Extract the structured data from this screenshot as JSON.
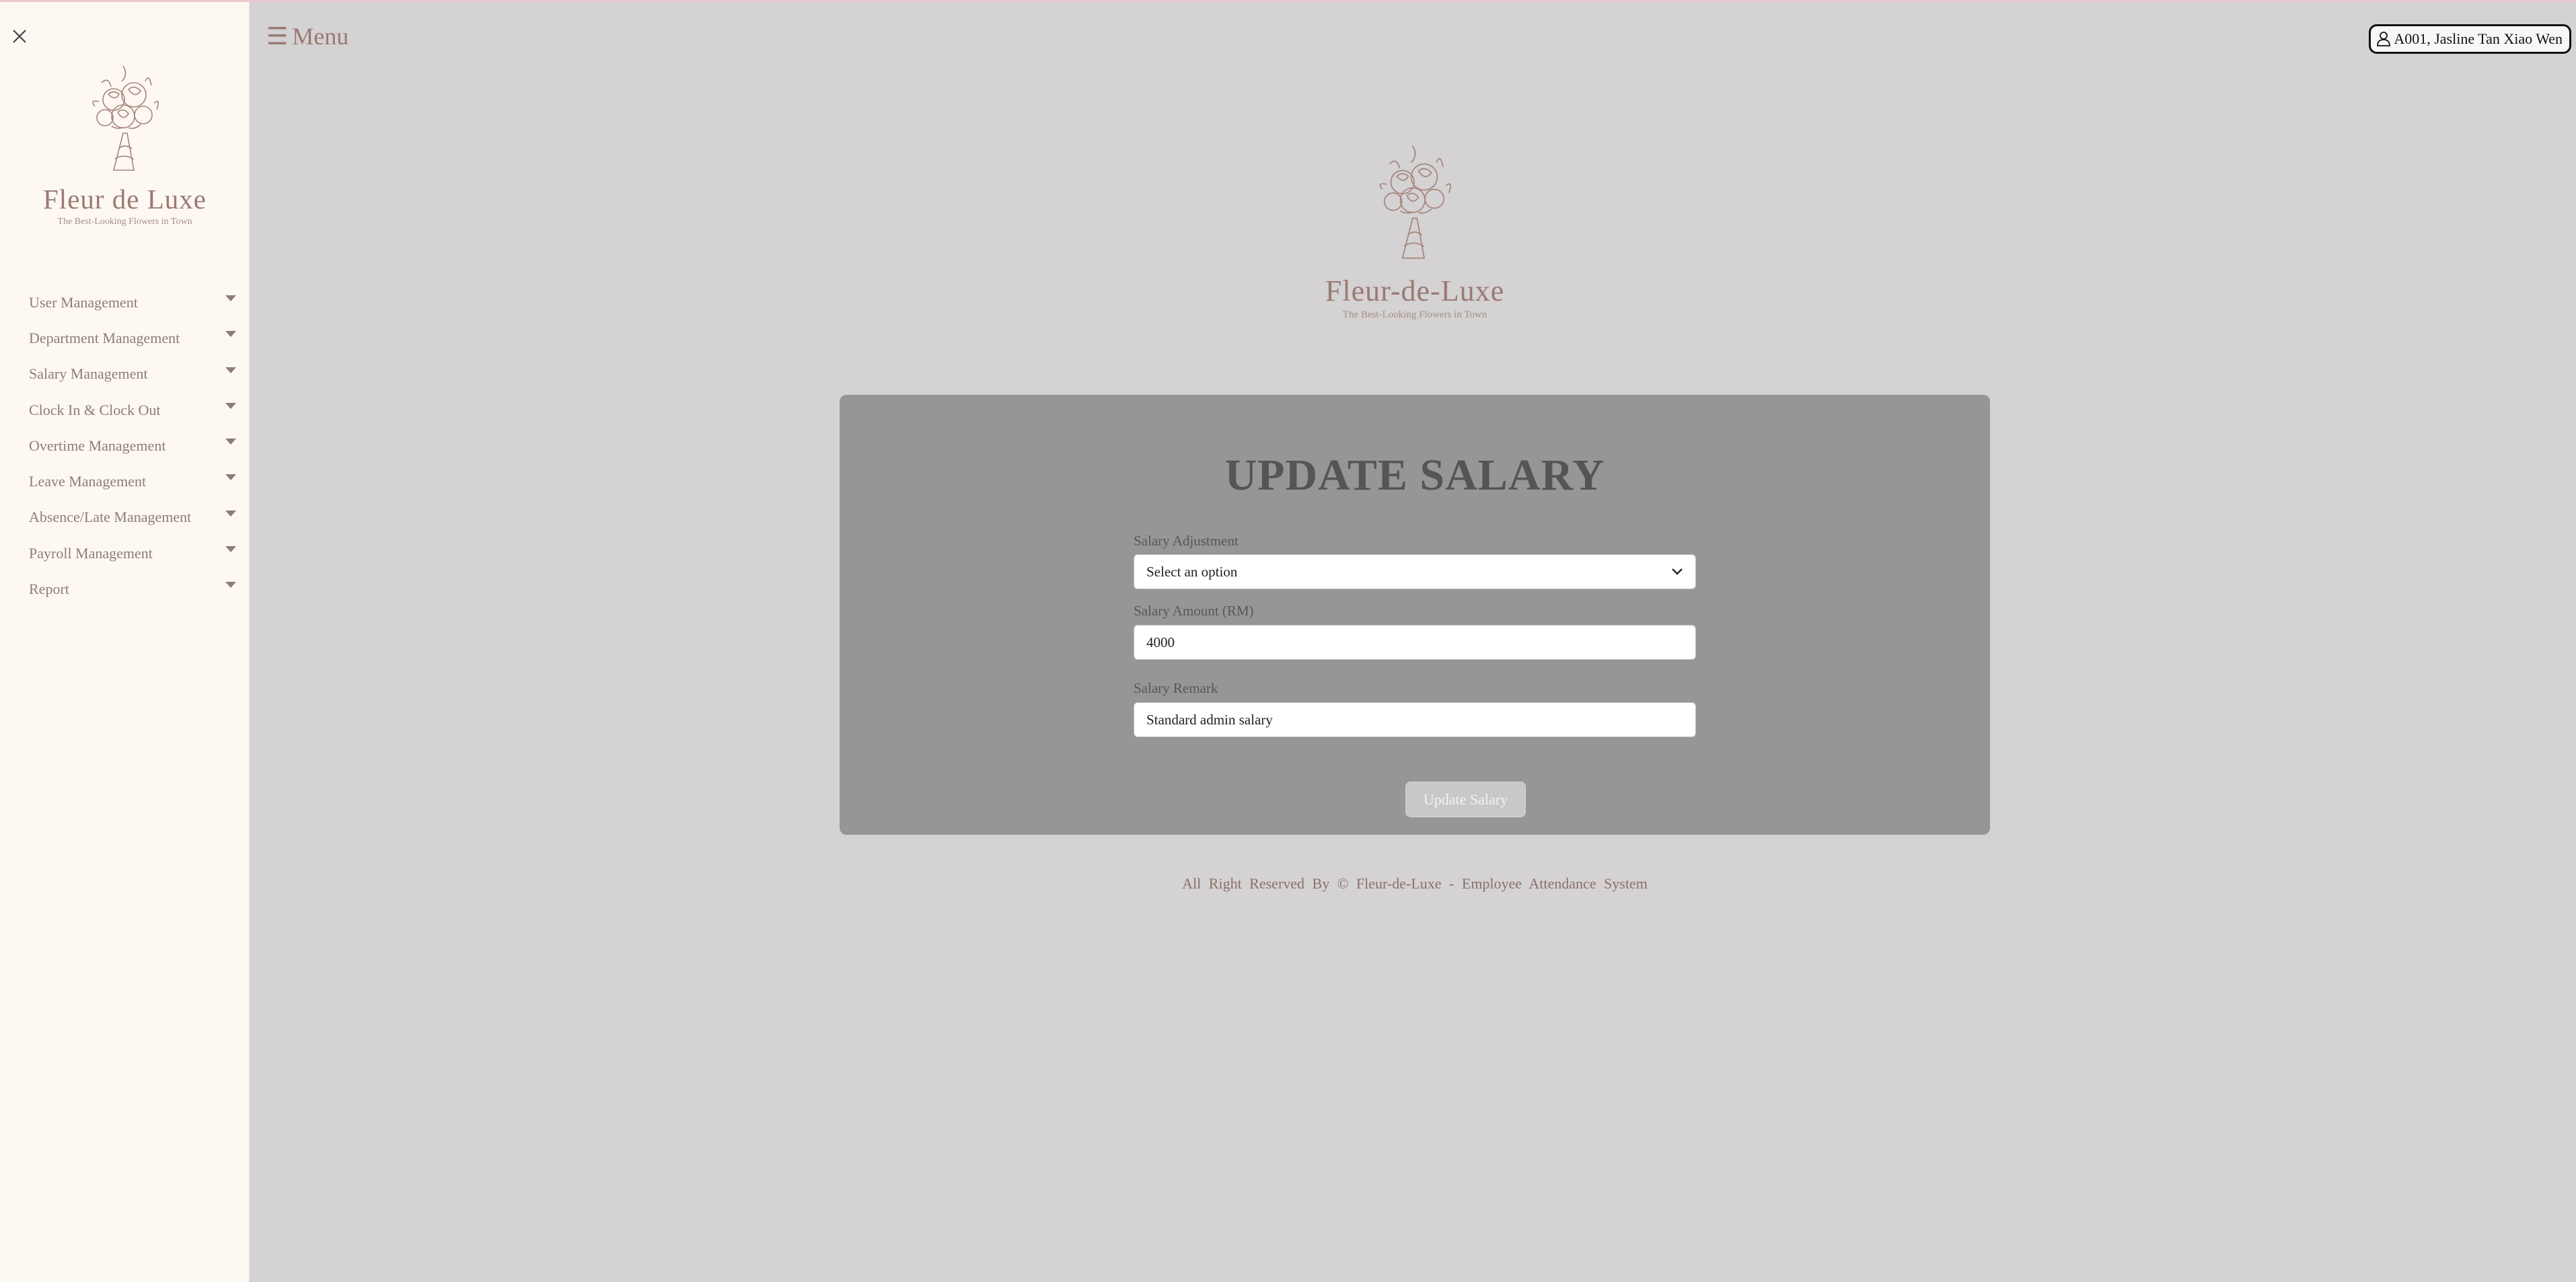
{
  "sidebar": {
    "brand_name": "Fleur de Luxe",
    "brand_tagline": "The Best-Looking Flowers in Town",
    "items": [
      {
        "label": "User Management"
      },
      {
        "label": "Department Management"
      },
      {
        "label": "Salary Management"
      },
      {
        "label": "Clock In & Clock Out"
      },
      {
        "label": "Overtime Management"
      },
      {
        "label": "Leave Management"
      },
      {
        "label": "Absence/Late Management"
      },
      {
        "label": "Payroll Management"
      },
      {
        "label": "Report"
      }
    ]
  },
  "header": {
    "menu_label": "Menu",
    "user_label": "A001, Jasline Tan Xiao Wen"
  },
  "main_logo": {
    "brand_name": "Fleur-de-Luxe",
    "brand_tagline": "The Best-Looking Flowers in Town"
  },
  "form": {
    "title": "UPDATE SALARY",
    "adjustment_label": "Salary Adjustment",
    "adjustment_value": "Select an option",
    "amount_label": "Salary Amount (RM)",
    "amount_value": "4000",
    "remark_label": "Salary Remark",
    "remark_value": "Standard admin salary",
    "submit_label": "Update Salary"
  },
  "footer": {
    "text": "All Right Reserved By © Fleur-de-Luxe - Employee Attendance System"
  },
  "colors": {
    "sidebar_bg": "#fdf8f1",
    "page_bg": "#d4d2d3",
    "card_bg": "#969696",
    "brand": "#9a7a72"
  },
  "icons": [
    "close-icon",
    "bouquet-logo-icon",
    "chevron-down-icon",
    "hamburger-icon",
    "user-icon"
  ]
}
